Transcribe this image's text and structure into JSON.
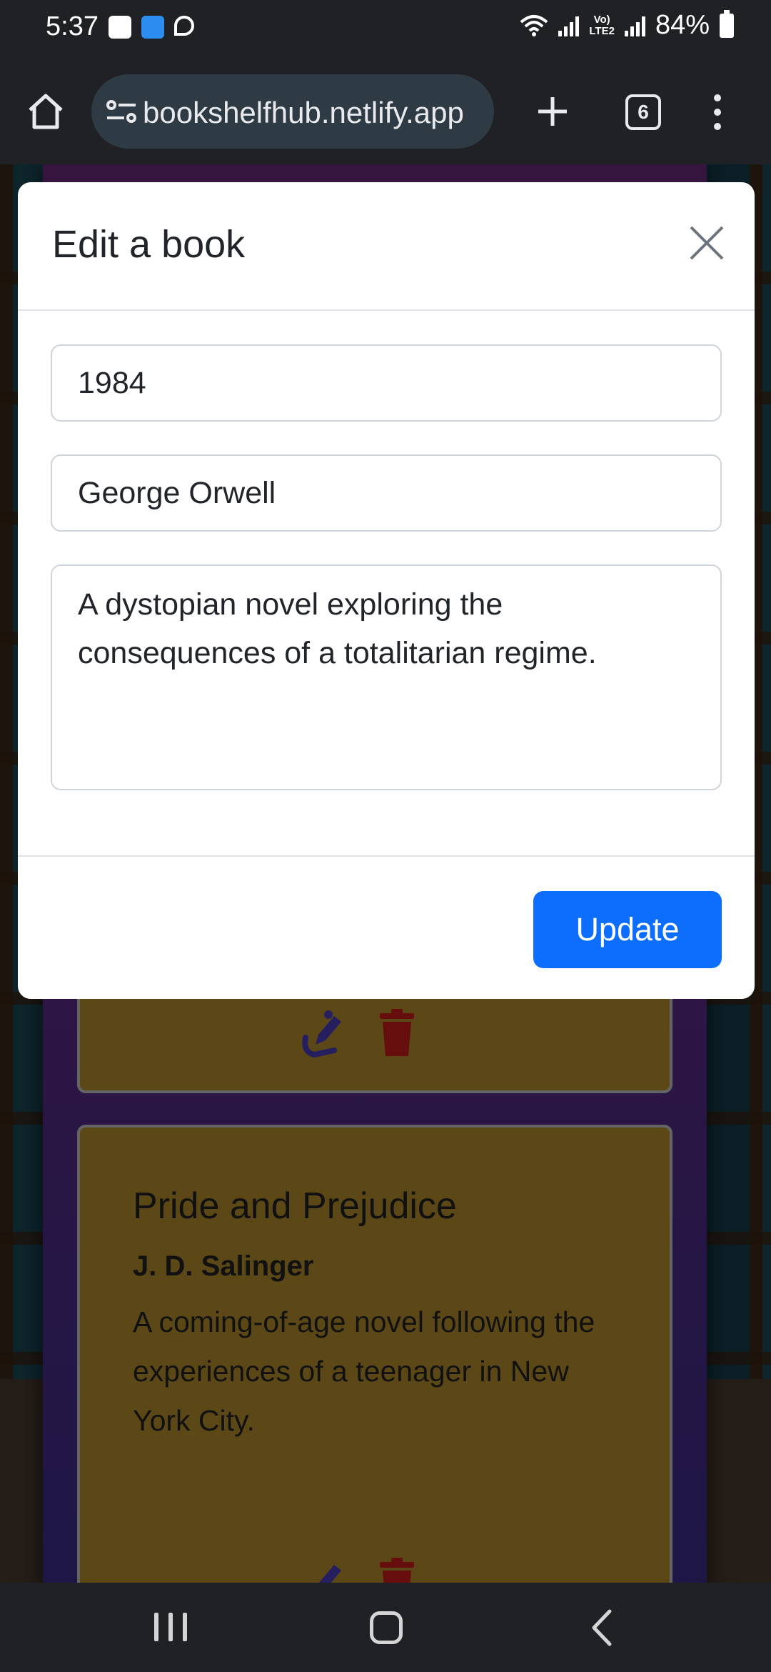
{
  "status_bar": {
    "time": "5:37",
    "lte_label_top": "Vo)",
    "lte_label_bottom": "LTE2",
    "battery": "84%"
  },
  "browser": {
    "url": "bookshelfhub.netlify.app",
    "tab_count": "6"
  },
  "modal": {
    "title": "Edit a book",
    "fields": {
      "title_value": "1984",
      "author_value": "George Orwell",
      "description_value": "A dystopian novel exploring the consequences of a totalitarian regime."
    },
    "update_label": "Update"
  },
  "books": [
    {
      "title": "Pride and Prejudice",
      "author": "J. D. Salinger",
      "description": "A coming-of-age novel following the experiences of a teenager in New York City."
    }
  ],
  "colors": {
    "primary": "#0d6efd",
    "card": "#b8912e",
    "edit_icon": "#4a3fbf",
    "delete_icon": "#cc1a1a"
  }
}
